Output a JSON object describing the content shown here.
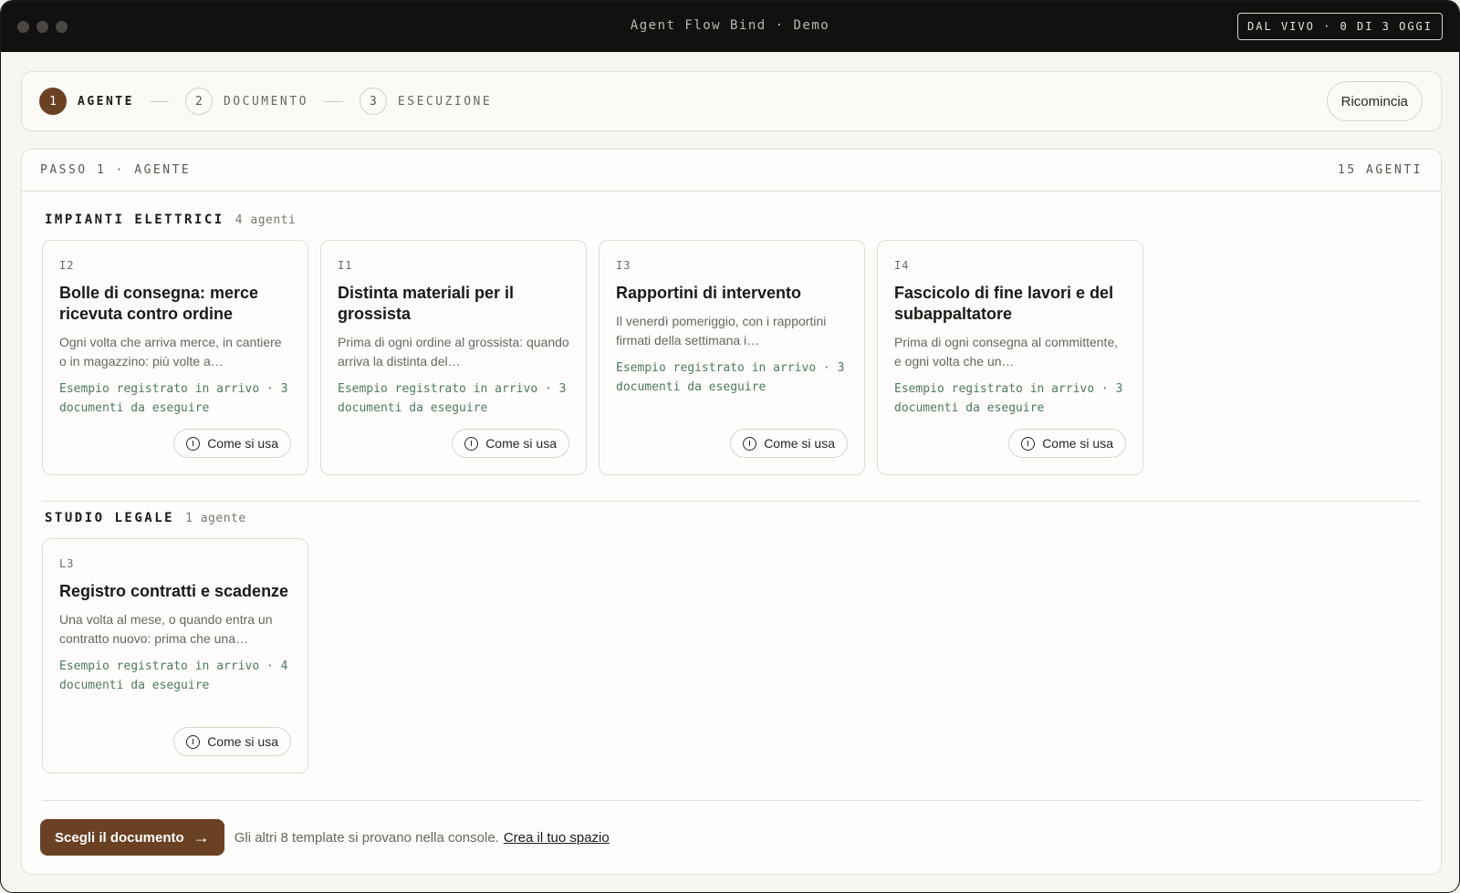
{
  "window": {
    "title": "Agent Flow Bind · Demo",
    "live_badge": "DAL VIVO · 0 DI 3 OGGI"
  },
  "stepper": {
    "steps": [
      {
        "num": "1",
        "label": "AGENTE"
      },
      {
        "num": "2",
        "label": "DOCUMENTO"
      },
      {
        "num": "3",
        "label": "ESECUZIONE"
      }
    ],
    "active_step": 1,
    "restart_label": "Ricomincia"
  },
  "panel": {
    "step_label": "PASSO 1 · AGENTE",
    "count_label": "15 AGENTI"
  },
  "groups": [
    {
      "title": "IMPIANTI ELETTRICI",
      "count": "4 agenti",
      "cards": [
        {
          "code": "I2",
          "title": "Bolle di consegna: merce ricevuta contro ordine",
          "desc": "Ogni volta che arriva merce, in cantiere o in magazzino: più volte a…",
          "meta": "Esempio registrato in arrivo · 3 documenti da eseguire",
          "howto": "Come si usa"
        },
        {
          "code": "I1",
          "title": "Distinta materiali per il grossista",
          "desc": "Prima di ogni ordine al grossista: quando arriva la distinta del…",
          "meta": "Esempio registrato in arrivo · 3 documenti da eseguire",
          "howto": "Come si usa"
        },
        {
          "code": "I3",
          "title": "Rapportini di intervento",
          "desc": "Il venerdì pomeriggio, con i rapportini firmati della settimana i…",
          "meta": "Esempio registrato in arrivo · 3 documenti da eseguire",
          "howto": "Come si usa"
        },
        {
          "code": "I4",
          "title": "Fascicolo di fine lavori e del subappaltatore",
          "desc": "Prima di ogni consegna al committente, e ogni volta che un…",
          "meta": "Esempio registrato in arrivo · 3 documenti da eseguire",
          "howto": "Come si usa"
        }
      ]
    },
    {
      "title": "STUDIO LEGALE",
      "count": "1 agente",
      "cards": [
        {
          "code": "L3",
          "title": "Registro contratti e scadenze",
          "desc": "Una volta al mese, o quando entra un contratto nuovo: prima che una…",
          "meta": "Esempio registrato in arrivo · 4 documenti da eseguire",
          "howto": "Come si usa"
        }
      ]
    }
  ],
  "footer": {
    "cta_label": "Scegli il documento",
    "cta_arrow": "→",
    "text": "Gli altri 8 template si provano nella console.",
    "link": "Crea il tuo spazio"
  }
}
